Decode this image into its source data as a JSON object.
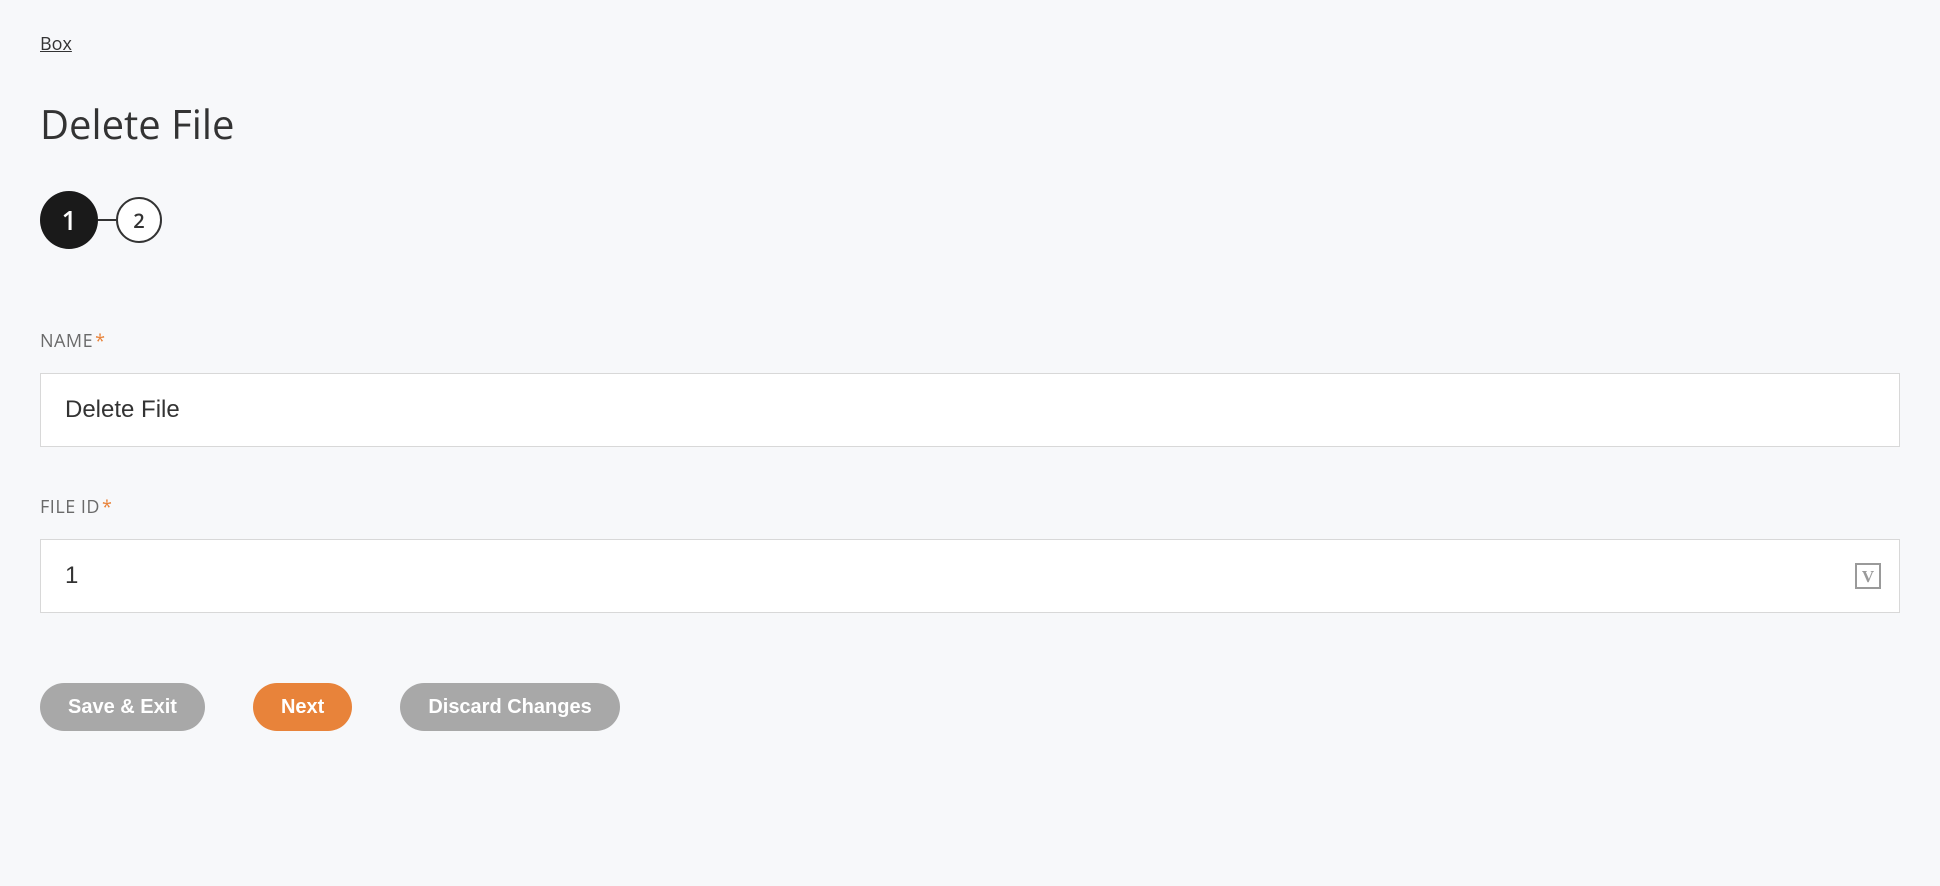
{
  "breadcrumb": {
    "label": "Box"
  },
  "page": {
    "title": "Delete File"
  },
  "stepper": {
    "steps": [
      {
        "number": "1",
        "state": "active"
      },
      {
        "number": "2",
        "state": "inactive"
      }
    ]
  },
  "form": {
    "name": {
      "label": "NAME",
      "required_mark": "*",
      "value": "Delete File"
    },
    "file_id": {
      "label": "FILE ID",
      "required_mark": "*",
      "value": "1"
    }
  },
  "buttons": {
    "save_exit": "Save & Exit",
    "next": "Next",
    "discard": "Discard Changes"
  }
}
